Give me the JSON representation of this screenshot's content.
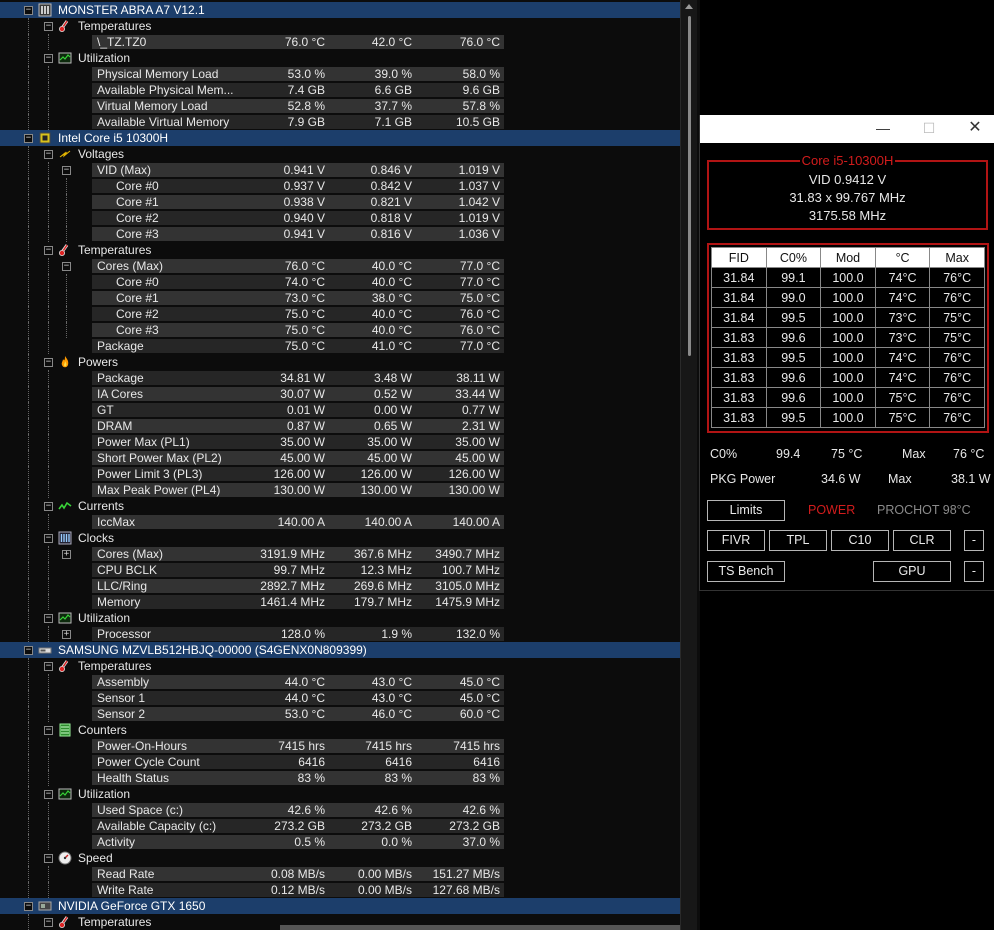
{
  "hwinfo": {
    "rows": [
      {
        "type": "device",
        "label": "MONSTER ABRA A7 V12.1",
        "icon": "motherboard-icon"
      },
      {
        "type": "group",
        "label": "Temperatures",
        "icon": "thermometer-icon"
      },
      {
        "type": "sensor",
        "label": "\\_TZ.TZ0",
        "v1": "76.0 °C",
        "v2": "42.0 °C",
        "v3": "76.0 °C"
      },
      {
        "type": "group",
        "label": "Utilization",
        "icon": "utilization-icon"
      },
      {
        "type": "sensor",
        "label": "Physical Memory Load",
        "v1": "53.0 %",
        "v2": "39.0 %",
        "v3": "58.0 %"
      },
      {
        "type": "sensor",
        "label": "Available Physical Mem...",
        "v1": "7.4 GB",
        "v2": "6.6 GB",
        "v3": "9.6 GB"
      },
      {
        "type": "sensor",
        "label": "Virtual Memory Load",
        "v1": "52.8 %",
        "v2": "37.7 %",
        "v3": "57.8 %"
      },
      {
        "type": "sensor",
        "label": "Available Virtual Memory",
        "v1": "7.9 GB",
        "v2": "7.1 GB",
        "v3": "10.5 GB"
      },
      {
        "type": "device",
        "label": "Intel Core i5 10300H",
        "icon": "cpu-icon"
      },
      {
        "type": "group",
        "label": "Voltages",
        "icon": "voltage-icon"
      },
      {
        "type": "subgroup",
        "label": "VID (Max)",
        "v1": "0.941 V",
        "v2": "0.846 V",
        "v3": "1.019 V"
      },
      {
        "type": "core",
        "label": "Core #0",
        "v1": "0.937 V",
        "v2": "0.842 V",
        "v3": "1.037 V"
      },
      {
        "type": "core",
        "label": "Core #1",
        "v1": "0.938 V",
        "v2": "0.821 V",
        "v3": "1.042 V"
      },
      {
        "type": "core",
        "label": "Core #2",
        "v1": "0.940 V",
        "v2": "0.818 V",
        "v3": "1.019 V"
      },
      {
        "type": "core",
        "label": "Core #3",
        "v1": "0.941 V",
        "v2": "0.816 V",
        "v3": "1.036 V"
      },
      {
        "type": "group",
        "label": "Temperatures",
        "icon": "thermometer-icon"
      },
      {
        "type": "subgroup",
        "label": "Cores (Max)",
        "v1": "76.0 °C",
        "v2": "40.0 °C",
        "v3": "77.0 °C"
      },
      {
        "type": "core",
        "label": "Core #0",
        "v1": "74.0 °C",
        "v2": "40.0 °C",
        "v3": "77.0 °C"
      },
      {
        "type": "core",
        "label": "Core #1",
        "v1": "73.0 °C",
        "v2": "38.0 °C",
        "v3": "75.0 °C"
      },
      {
        "type": "core",
        "label": "Core #2",
        "v1": "75.0 °C",
        "v2": "40.0 °C",
        "v3": "76.0 °C"
      },
      {
        "type": "core",
        "label": "Core #3",
        "v1": "75.0 °C",
        "v2": "40.0 °C",
        "v3": "76.0 °C"
      },
      {
        "type": "sensor",
        "label": "Package",
        "v1": "75.0 °C",
        "v2": "41.0 °C",
        "v3": "77.0 °C"
      },
      {
        "type": "group",
        "label": "Powers",
        "icon": "flame-icon"
      },
      {
        "type": "sensor",
        "label": "Package",
        "v1": "34.81 W",
        "v2": "3.48 W",
        "v3": "38.11 W"
      },
      {
        "type": "sensor",
        "label": "IA Cores",
        "v1": "30.07 W",
        "v2": "0.52 W",
        "v3": "33.44 W"
      },
      {
        "type": "sensor",
        "label": "GT",
        "v1": "0.01 W",
        "v2": "0.00 W",
        "v3": "0.77 W"
      },
      {
        "type": "sensor",
        "label": "DRAM",
        "v1": "0.87 W",
        "v2": "0.65 W",
        "v3": "2.31 W"
      },
      {
        "type": "sensor",
        "label": "Power Max (PL1)",
        "v1": "35.00 W",
        "v2": "35.00 W",
        "v3": "35.00 W"
      },
      {
        "type": "sensor",
        "label": "Short Power Max (PL2)",
        "v1": "45.00 W",
        "v2": "45.00 W",
        "v3": "45.00 W"
      },
      {
        "type": "sensor",
        "label": "Power Limit 3 (PL3)",
        "v1": "126.00 W",
        "v2": "126.00 W",
        "v3": "126.00 W"
      },
      {
        "type": "sensor",
        "label": "Max Peak Power (PL4)",
        "v1": "130.00 W",
        "v2": "130.00 W",
        "v3": "130.00 W"
      },
      {
        "type": "group",
        "label": "Currents",
        "icon": "current-icon"
      },
      {
        "type": "sensor",
        "label": "IccMax",
        "v1": "140.00 A",
        "v2": "140.00 A",
        "v3": "140.00 A"
      },
      {
        "type": "group",
        "label": "Clocks",
        "icon": "clock-icon"
      },
      {
        "type": "subgroup-collapsed",
        "label": "Cores (Max)",
        "v1": "3191.9 MHz",
        "v2": "367.6 MHz",
        "v3": "3490.7 MHz"
      },
      {
        "type": "sensor",
        "label": "CPU BCLK",
        "v1": "99.7 MHz",
        "v2": "12.3 MHz",
        "v3": "100.7 MHz"
      },
      {
        "type": "sensor",
        "label": "LLC/Ring",
        "v1": "2892.7 MHz",
        "v2": "269.6 MHz",
        "v3": "3105.0 MHz"
      },
      {
        "type": "sensor",
        "label": "Memory",
        "v1": "1461.4 MHz",
        "v2": "179.7 MHz",
        "v3": "1475.9 MHz"
      },
      {
        "type": "group",
        "label": "Utilization",
        "icon": "utilization-icon"
      },
      {
        "type": "subgroup-collapsed",
        "label": "Processor",
        "v1": "128.0 %",
        "v2": "1.9 %",
        "v3": "132.0 %"
      },
      {
        "type": "device",
        "label": "SAMSUNG MZVLB512HBJQ-00000 (S4GENX0N809399)",
        "icon": "drive-icon"
      },
      {
        "type": "group",
        "label": "Temperatures",
        "icon": "thermometer-icon"
      },
      {
        "type": "sensor",
        "label": "Assembly",
        "v1": "44.0 °C",
        "v2": "43.0 °C",
        "v3": "45.0 °C"
      },
      {
        "type": "sensor",
        "label": "Sensor 1",
        "v1": "44.0 °C",
        "v2": "43.0 °C",
        "v3": "45.0 °C"
      },
      {
        "type": "sensor",
        "label": "Sensor 2",
        "v1": "53.0 °C",
        "v2": "46.0 °C",
        "v3": "60.0 °C"
      },
      {
        "type": "group",
        "label": "Counters",
        "icon": "counter-icon"
      },
      {
        "type": "sensor",
        "label": "Power-On-Hours",
        "v1": "7415 hrs",
        "v2": "7415 hrs",
        "v3": "7415 hrs"
      },
      {
        "type": "sensor",
        "label": "Power Cycle Count",
        "v1": "6416",
        "v2": "6416",
        "v3": "6416"
      },
      {
        "type": "sensor",
        "label": "Health Status",
        "v1": "83 %",
        "v2": "83 %",
        "v3": "83 %"
      },
      {
        "type": "group",
        "label": "Utilization",
        "icon": "utilization-icon"
      },
      {
        "type": "sensor",
        "label": "Used Space (c:)",
        "v1": "42.6 %",
        "v2": "42.6 %",
        "v3": "42.6 %"
      },
      {
        "type": "sensor",
        "label": "Available Capacity (c:)",
        "v1": "273.2 GB",
        "v2": "273.2 GB",
        "v3": "273.2 GB"
      },
      {
        "type": "sensor",
        "label": "Activity",
        "v1": "0.5 %",
        "v2": "0.0 %",
        "v3": "37.0 %"
      },
      {
        "type": "group",
        "label": "Speed",
        "icon": "speedometer-icon"
      },
      {
        "type": "sensor",
        "label": "Read Rate",
        "v1": "0.08 MB/s",
        "v2": "0.00 MB/s",
        "v3": "151.27 MB/s"
      },
      {
        "type": "sensor",
        "label": "Write Rate",
        "v1": "0.12 MB/s",
        "v2": "0.00 MB/s",
        "v3": "127.68 MB/s"
      },
      {
        "type": "device",
        "label": "NVIDIA GeForce GTX 1650",
        "icon": "gpu-icon"
      },
      {
        "type": "group",
        "label": "Temperatures",
        "icon": "thermometer-icon"
      }
    ]
  },
  "throttlestop": {
    "window_buttons": {
      "minimize": "—",
      "maximize": "☐",
      "close": "✕"
    },
    "cpu_name": "Core i5-10300H",
    "vid": "VID  0.9412 V",
    "multiplier": "31.83 x 99.767 MHz",
    "frequency": "3175.58 MHz",
    "table_headers": [
      "FID",
      "C0%",
      "Mod",
      "°C",
      "Max"
    ],
    "table_rows": [
      [
        "31.84",
        "99.1",
        "100.0",
        "74°C",
        "76°C"
      ],
      [
        "31.84",
        "99.0",
        "100.0",
        "74°C",
        "76°C"
      ],
      [
        "31.84",
        "99.5",
        "100.0",
        "73°C",
        "75°C"
      ],
      [
        "31.83",
        "99.6",
        "100.0",
        "73°C",
        "75°C"
      ],
      [
        "31.83",
        "99.5",
        "100.0",
        "74°C",
        "76°C"
      ],
      [
        "31.83",
        "99.6",
        "100.0",
        "74°C",
        "76°C"
      ],
      [
        "31.83",
        "99.6",
        "100.0",
        "75°C",
        "76°C"
      ],
      [
        "31.83",
        "99.5",
        "100.0",
        "75°C",
        "76°C"
      ]
    ],
    "c0_label": "C0%",
    "c0_value": "99.4",
    "temp_value": "75 °C",
    "max_label": "Max",
    "max_temp": "76 °C",
    "pkg_label": "PKG Power",
    "pkg_value": "34.6 W",
    "pkg_max_label": "Max",
    "pkg_max": "38.1 W",
    "limits_button": "Limits",
    "power_label": "POWER",
    "prochot_label": "PROCHOT 98°C",
    "buttons_row": [
      "FIVR",
      "TPL",
      "C10",
      "CLR",
      "-"
    ],
    "ts_bench_button": "TS Bench",
    "gpu_button": "GPU",
    "gpu_dash": "-",
    "colors": {
      "accent_red": "#d21c1c",
      "border_red": "#b11414",
      "device_row": "#1c3e6b"
    }
  }
}
